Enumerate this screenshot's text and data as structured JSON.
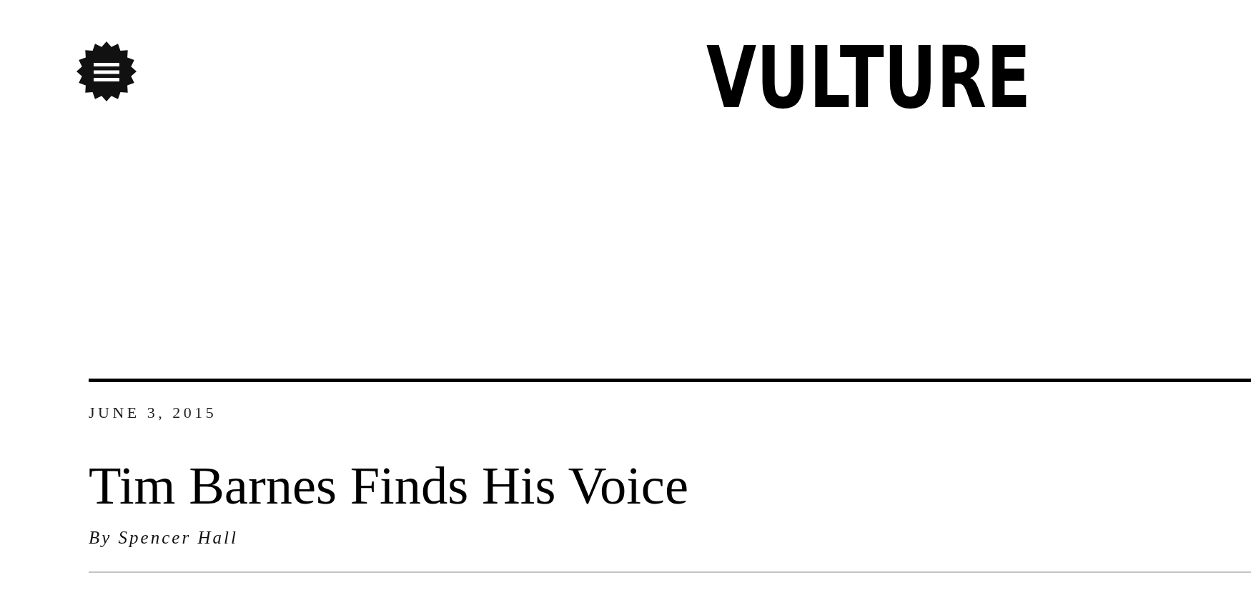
{
  "header": {
    "logo": "VULTURE"
  },
  "article": {
    "date": "JUNE 3, 2015",
    "title": "Tim Barnes Finds His Voice",
    "byline": "By Spencer Hall"
  }
}
